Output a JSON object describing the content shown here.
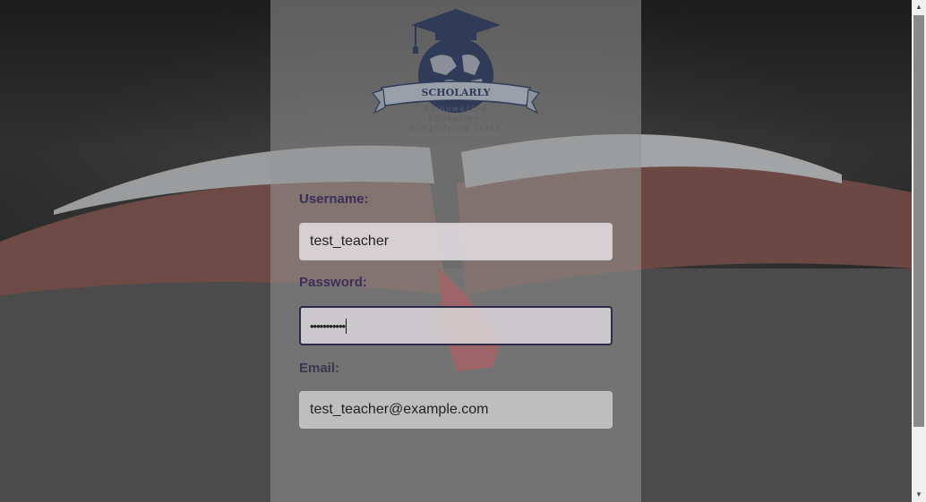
{
  "logo": {
    "brand": "SCHOLARLY",
    "tagline_lines": [
      "Empowering",
      "Education,",
      "Simplifying Tasks"
    ]
  },
  "form": {
    "username_label": "Username:",
    "username_value": "test_teacher",
    "password_label": "Password:",
    "password_value_masked": "•••••••••••",
    "email_label": "Email:",
    "email_value": "test_teacher@example.com"
  },
  "colors": {
    "label": "#3b2f57",
    "focus_border": "#2c2b4a",
    "logo_navy": "#2f3b57"
  },
  "icons": {
    "scroll_up": "scroll-up-arrow-icon",
    "scroll_down": "scroll-down-arrow-icon"
  }
}
